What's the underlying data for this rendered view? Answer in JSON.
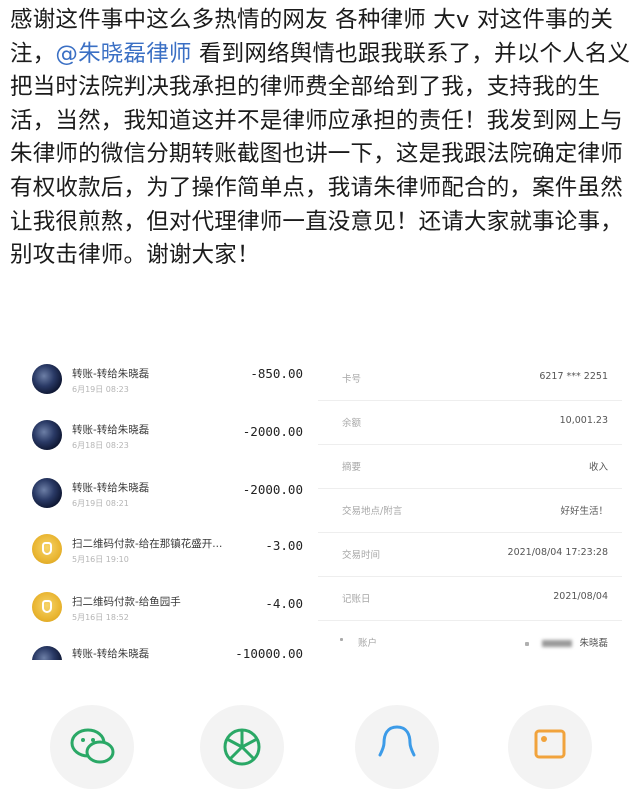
{
  "post": {
    "text_before": "感谢这件事中这么多热情的网友 各种律师 大v 对这件事的关注，",
    "mention": "@朱晓磊律师",
    "text_after": " 看到网络舆情也跟我联系了，并以个人名义把当时法院判决我承担的律师费全部给到了我，支持我的生活，当然，我知道这并不是律师应承担的责任！我发到网上与朱律师的微信分期转账截图也讲一下，这是我跟法院确定律师有权收款后，为了操作简单点，我请朱律师配合的，案件虽然让我很煎熬，但对代理律师一直没意见！还请大家就事论事，别攻击律师。谢谢大家！"
  },
  "transactions": [
    {
      "title": "转账-转给朱晓磊",
      "date": "6月19日 08:23",
      "amount": "-850.00",
      "avatar": "photo"
    },
    {
      "title": "转账-转给朱晓磊",
      "date": "6月18日 08:23",
      "amount": "-2000.00",
      "avatar": "photo"
    },
    {
      "title": "转账-转给朱晓磊",
      "date": "6月19日 08:21",
      "amount": "-2000.00",
      "avatar": "photo"
    },
    {
      "title": "扫二维码付款-给在那镇花盛开...",
      "date": "5月16日 19:10",
      "amount": "-3.00",
      "avatar": "gold"
    },
    {
      "title": "扫二维码付款-给鱼园手",
      "date": "5月16日 18:52",
      "amount": "-4.00",
      "avatar": "gold"
    },
    {
      "title": "转账-转给朱晓磊",
      "date": "",
      "amount": "-10000.00",
      "avatar": "photo"
    }
  ],
  "details": [
    {
      "label": "卡号",
      "value": "6217 *** 2251"
    },
    {
      "label": "余额",
      "value": "10,001.23"
    },
    {
      "label": "摘要",
      "value": "收入"
    },
    {
      "label": "交易地点/附言",
      "value": "好好生活！"
    },
    {
      "label": "交易时间",
      "value": "2021/08/04 17:23:28"
    },
    {
      "label": "记账日",
      "value": "2021/08/04"
    },
    {
      "label": "账户",
      "value": "朱晓磊"
    }
  ],
  "share": [
    {
      "name": "wechat-icon"
    },
    {
      "name": "moments-icon"
    },
    {
      "name": "qq-icon"
    },
    {
      "name": "image-icon"
    }
  ],
  "colors": {
    "mention": "#3a6fc4",
    "share_icon": "#2aa866",
    "qq_icon": "#3c9be8",
    "image_icon": "#f1a33c"
  }
}
